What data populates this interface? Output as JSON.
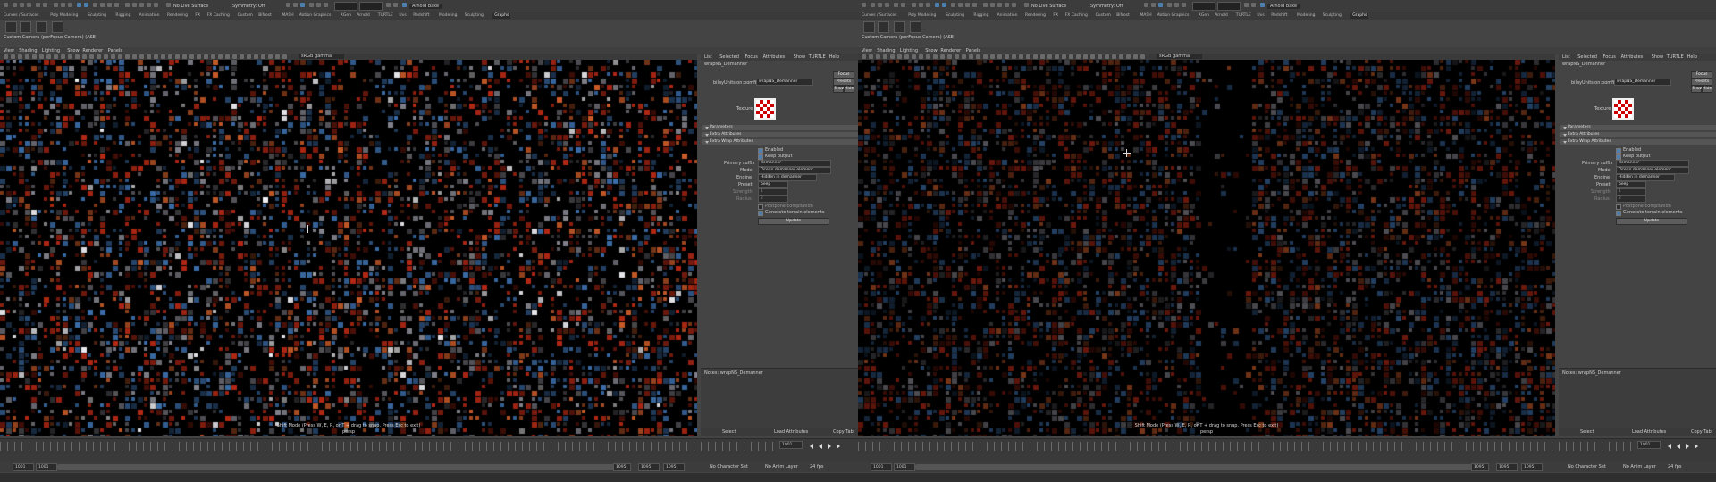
{
  "colors": {
    "accent": "#4d7fb0",
    "viewport_bg": "#000000",
    "ui_bg": "#444444"
  },
  "panes": [
    {
      "id": "left",
      "toolbar": {
        "search_label": "No Live Surface",
        "symmetry_label": "Symmetry: Off",
        "workspace": "Arnold Bake"
      },
      "shelf_tabs": [
        "Curves / Surfaces",
        "Poly Modeling",
        "Sculpting",
        "Rigging",
        "Animation",
        "Rendering",
        "FX",
        "FX Caching",
        "Custom",
        "Bifrost",
        "MASH",
        "Motion Graphics",
        "XGen",
        "Arnold",
        "TURTLE",
        "Uvs",
        "Redshift",
        "Modeling",
        "Sculpting",
        "Graphs"
      ],
      "shelf_active": "Graphs",
      "title": "Custom Camera (perFocus Camera) (ASE",
      "panel_menu": [
        "View",
        "Shading",
        "Lighting",
        "Show",
        "Renderer",
        "Panels"
      ],
      "color_space": "sRGB gamma",
      "hud_status": "Shift Mode (Press W, E, R, or T + drag to snap. Press Esc to exit)",
      "hud_camera": "persp",
      "attr": {
        "tabs": [
          "List",
          "Selected",
          "Focus",
          "Attributes",
          "Show",
          "TURTLE",
          "Help"
        ],
        "node_name": "wrapNS_Demanner",
        "node_label": "bilayUnitsion:bomfi",
        "node_field": "wrapNS_Demanner",
        "focus_btn": "Focus",
        "presets_btn": "Presets",
        "show_btn": "Show",
        "hide_btn": "Hide",
        "texture_label": "Texture",
        "sections": [
          "Parameters",
          "Extra Attributes",
          "Extra Wrap Attributes"
        ],
        "enabled_label": "Enabled",
        "keep_output_label": "Keep output",
        "primary_label": "Primary suffix",
        "primary_value": "demanner",
        "mode_label": "Mode",
        "mode_value": "Ocean demanner element",
        "engine_label": "Engine",
        "engine_value": "Hidden in demanner",
        "preset_label": "Preset",
        "preset_value": "beep",
        "strength_label": "Strength",
        "radius_label": "Radius",
        "strength_value": "1",
        "radius_value": "2",
        "opt1_label": "Postpone compilation",
        "opt2_label": "Generate terrain elements",
        "update_btn": "Update",
        "notes_label": "Notes: wrapNS_Demanner",
        "select_btn": "Select",
        "load_btn": "Load Attributes",
        "copy_btn": "Copy Tab"
      },
      "timeline": {
        "current": "1001",
        "start": "1001",
        "end": "1095",
        "range_start": "1001",
        "range_end": "1095",
        "anim_start": "1001",
        "anim_end": "1095",
        "char_set": "No Character Set",
        "anim_layer": "No Anim Layer",
        "fps": "24 fps"
      }
    },
    {
      "id": "right",
      "toolbar": {
        "search_label": "No Live Surface",
        "symmetry_label": "Symmetry: Off",
        "workspace": "Arnold Bake"
      },
      "shelf_tabs": [
        "Curves / Surfaces",
        "Poly Modeling",
        "Sculpting",
        "Rigging",
        "Animation",
        "Rendering",
        "FX",
        "FX Caching",
        "Custom",
        "Bifrost",
        "MASH",
        "Motion Graphics",
        "XGen",
        "Arnold",
        "TURTLE",
        "Uvs",
        "Redshift",
        "Modeling",
        "Sculpting",
        "Graphs"
      ],
      "shelf_active": "Graphs",
      "title": "Custom Camera (perFocus Camera) (ASE",
      "panel_menu": [
        "View",
        "Shading",
        "Lighting",
        "Show",
        "Renderer",
        "Panels"
      ],
      "color_space": "sRGB gamma",
      "hud_status": "Shift Mode (Press W, E, R, or T + drag to snap. Press Esc to exit)",
      "hud_camera": "persp",
      "attr": {
        "tabs": [
          "List",
          "Selected",
          "Focus",
          "Attributes",
          "Show",
          "TURTLE",
          "Help"
        ],
        "node_name": "wrapNS_Demanner",
        "node_label": "bilayUnitsion:bomfi",
        "node_field": "wrapNS_Demanner",
        "focus_btn": "Focus",
        "presets_btn": "Presets",
        "show_btn": "Show",
        "hide_btn": "Hide",
        "texture_label": "Texture",
        "sections": [
          "Parameters",
          "Extra Attributes",
          "Extra Wrap Attributes"
        ],
        "enabled_label": "Enabled",
        "keep_output_label": "Keep output",
        "primary_label": "Primary suffix",
        "primary_value": "demanner",
        "mode_label": "Mode",
        "mode_value": "Ocean demanner element",
        "engine_label": "Engine",
        "engine_value": "Hidden in demanner",
        "preset_label": "Preset",
        "preset_value": "beep",
        "strength_label": "Strength",
        "radius_label": "Radius",
        "strength_value": "1",
        "radius_value": "2",
        "opt1_label": "Postpone compilation",
        "opt2_label": "Generate terrain elements",
        "update_btn": "Update",
        "notes_label": "Notes: wrapNS_Demanner",
        "select_btn": "Select",
        "load_btn": "Load Attributes",
        "copy_btn": "Copy Tab"
      },
      "timeline": {
        "current": "1001",
        "start": "1001",
        "end": "1095",
        "range_start": "1001",
        "range_end": "1095",
        "anim_start": "1001",
        "anim_end": "1095",
        "char_set": "No Character Set",
        "anim_layer": "No Anim Layer",
        "fps": "24 fps"
      }
    }
  ]
}
